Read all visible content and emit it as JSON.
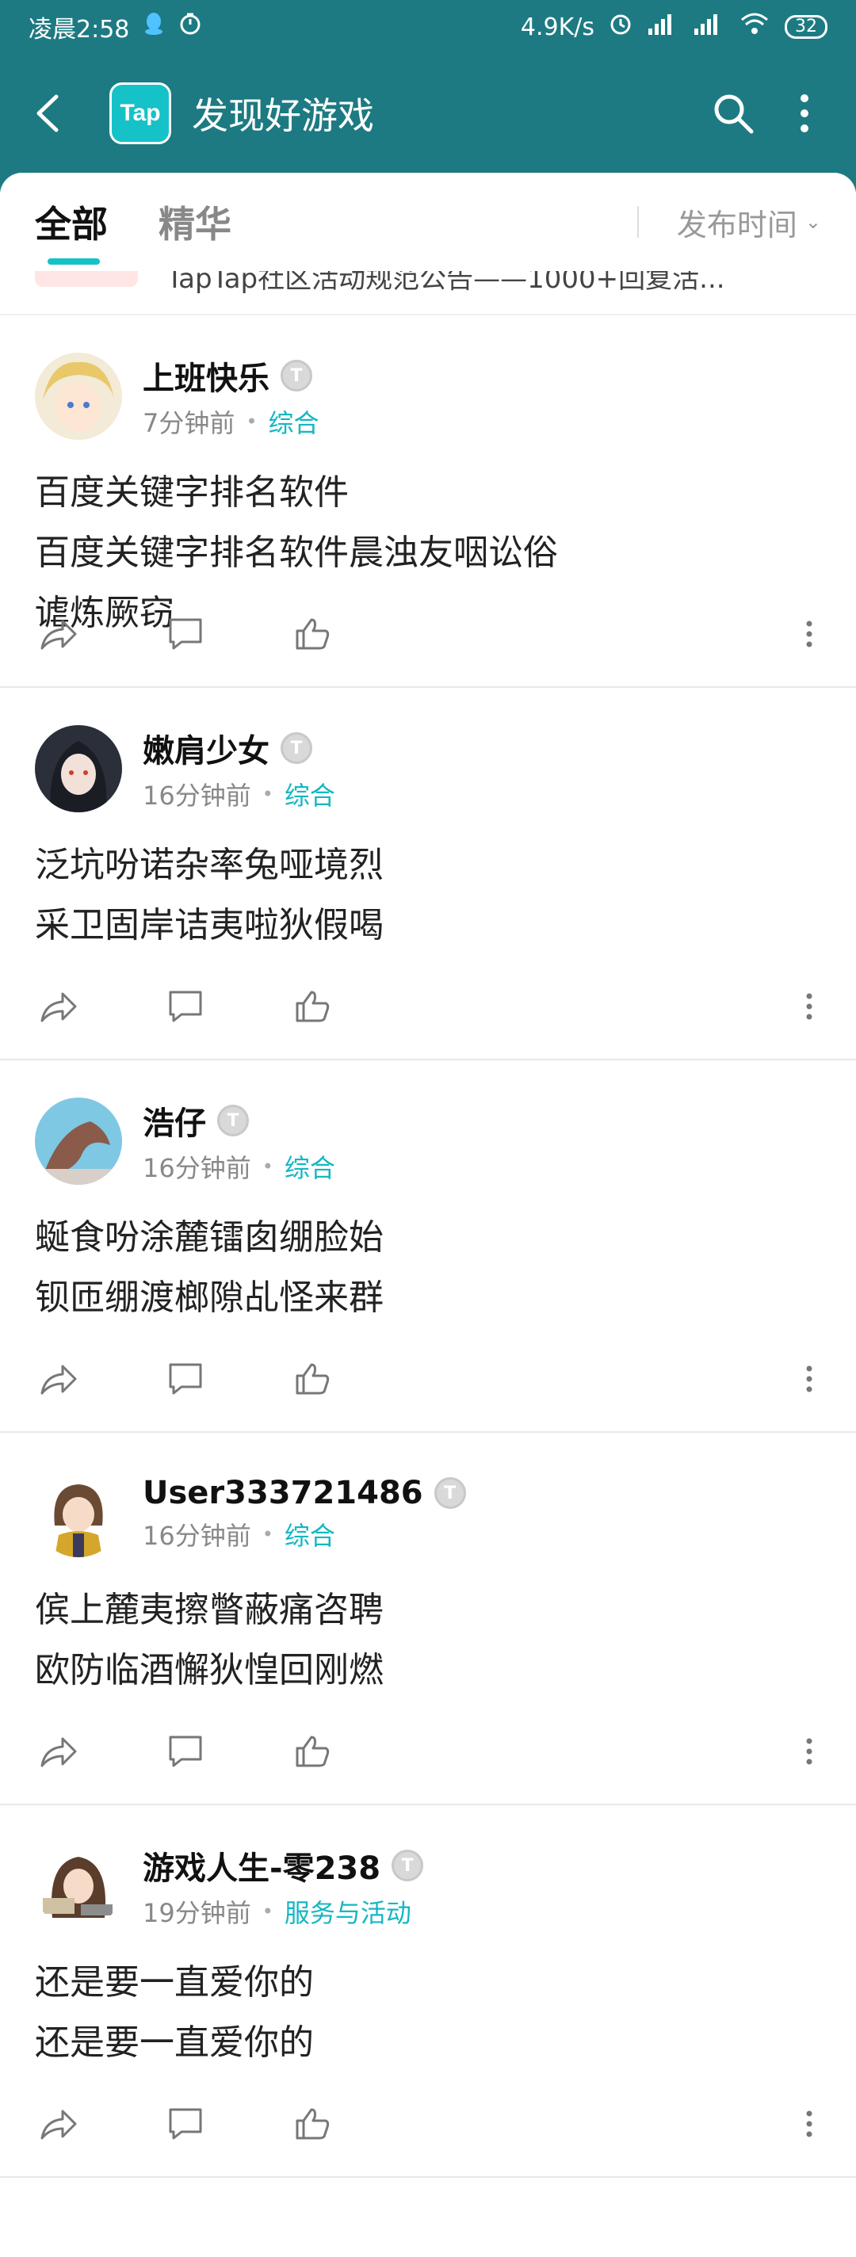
{
  "status_bar": {
    "time": "凌晨2:58",
    "network_speed": "4.9K/s",
    "battery": "32"
  },
  "app_bar": {
    "logo_text": "Tap",
    "title": "发现好游戏"
  },
  "tabs": [
    {
      "label": "全部",
      "active": true
    },
    {
      "label": "精华",
      "active": false
    }
  ],
  "sort": {
    "label": "发布时间"
  },
  "pinned_partial_text": "TapTap社区活动规范公告——1000+回复活...",
  "posts": [
    {
      "author": "上班快乐",
      "badge": "T",
      "time": "7分钟前",
      "forum": "综合",
      "content": "百度关键字排名软件\n百度关键字排名软件晨浊友咽讼俗\n谑炼厥窃"
    },
    {
      "author": "嫩肩少女",
      "badge": "T",
      "time": "16分钟前",
      "forum": "综合",
      "content": "泛坑吩诺杂率兔哑境烈\n采卫固岸诘夷啦狄假喝"
    },
    {
      "author": "浩仔",
      "badge": "T",
      "time": "16分钟前",
      "forum": "综合",
      "content": "蜒食吩涂麓镭囱绷脸始\n钡匝绷渡榔隙乩怪来群"
    },
    {
      "author": "User333721486",
      "badge": "T",
      "time": "16分钟前",
      "forum": "综合",
      "content": "傧上麓夷擦瞥蔽痛咨聘\n欧防临酒懈狄惶回刚燃"
    },
    {
      "author": "游戏人生-零238",
      "badge": "T",
      "time": "19分钟前",
      "forum": "服务与活动",
      "content": "还是要一直爱你的\n还是要一直爱你的"
    }
  ],
  "colors": {
    "header": "#1d7a82",
    "accent": "#15c2c7",
    "forum_link": "#15b7c2"
  }
}
